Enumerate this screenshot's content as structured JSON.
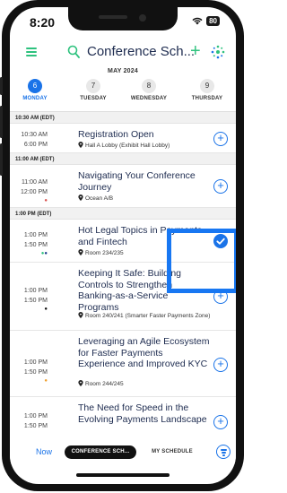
{
  "status": {
    "time": "8:20",
    "battery": "80"
  },
  "header": {
    "title": "Conference Sch..."
  },
  "month": "MAY 2024",
  "days": [
    {
      "num": "6",
      "label": "MONDAY",
      "selected": true
    },
    {
      "num": "7",
      "label": "TUESDAY",
      "selected": false
    },
    {
      "num": "8",
      "label": "WEDNESDAY",
      "selected": false
    },
    {
      "num": "9",
      "label": "THURSDAY",
      "selected": false
    }
  ],
  "blocks": [
    {
      "header": "10:30 AM (EDT)"
    },
    {
      "header": "11:00 AM (EDT)"
    },
    {
      "header": "1:00 PM (EDT)"
    }
  ],
  "sessions": [
    {
      "start": "10:30 AM",
      "end": "6:00 PM",
      "title": "Registration Open",
      "location": "Hall A Lobby (Exhibit Hall Lobby)",
      "added": false
    },
    {
      "start": "11:00 AM",
      "end": "12:00 PM",
      "title": "Navigating Your Conference Journey",
      "location": "Ocean A/B",
      "added": false
    },
    {
      "start": "1:00 PM",
      "end": "1:50 PM",
      "title": "Hot Legal Topics in Payments and Fintech",
      "location": "Room 234/235",
      "added": true
    },
    {
      "start": "1:00 PM",
      "end": "1:50 PM",
      "title": "Keeping It Safe: Building Controls to Strengthen Banking-as-a-Service Programs",
      "location": "Room 240/241 (Smarter Faster Payments Zone)",
      "added": false
    },
    {
      "start": "1:00 PM",
      "end": "1:50 PM",
      "title": "Leveraging an Agile Ecosystem for Faster Payments Experience and Improved KYC",
      "location": "Room 244/245",
      "added": false
    },
    {
      "start": "1:00 PM",
      "end": "1:50 PM",
      "title": "The Need for Speed in the Evolving Payments Landscape",
      "location": "",
      "added": false
    }
  ],
  "bottom": {
    "now": "Now",
    "tab_active": "CONFERENCE SCH...",
    "tab_inactive": "MY SCHEDULE"
  },
  "colors": {
    "accent": "#1a73e8",
    "brand_green": "#2ec27e",
    "highlight": "#1877f2"
  }
}
